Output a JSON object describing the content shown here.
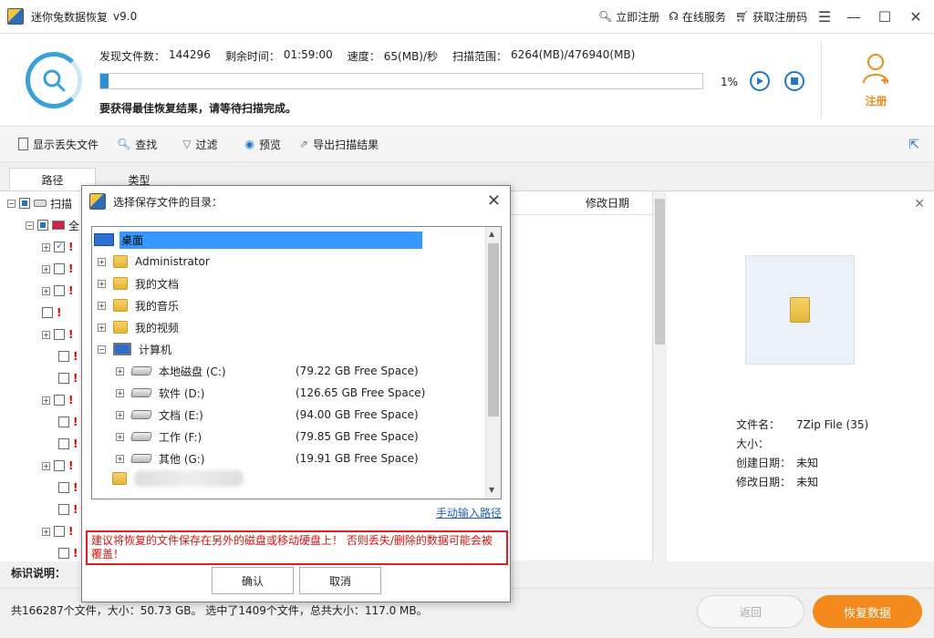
{
  "app": {
    "title": "迷你兔数据恢复",
    "version": "v9.0"
  },
  "titlebar": {
    "register": "立即注册",
    "service": "在线服务",
    "get_code": "获取注册码"
  },
  "scan": {
    "found_label": "发现文件数：",
    "found_value": "144296",
    "remain_label": "剩余时间：",
    "remain_value": "01:59:00",
    "speed_label": "速度：",
    "speed_value": "65(MB)/秒",
    "range_label": "扫描范围：",
    "range_value": "6264(MB)/476940(MB)",
    "progress_text": "1%",
    "progress_fraction": 0.013,
    "hint": "要获得最佳恢复结果，请等待扫描完成。",
    "register_label": "注册"
  },
  "toolbar": {
    "show_lost": "显示丢失文件",
    "find": "查找",
    "filter": "过滤",
    "preview": "预览",
    "export": "导出扫描结果"
  },
  "tabs": [
    "路径",
    "类型"
  ],
  "tree": {
    "root_label": "扫描",
    "child_label": "全"
  },
  "list": {
    "col_modified": "修改日期"
  },
  "preview": {
    "name_label": "文件名：",
    "name_value": "7Zip File (35)",
    "size_label": "大小：",
    "size_value": "",
    "created_label": "创建日期：",
    "created_value": "未知",
    "modified_label": "修改日期：",
    "modified_value": "未知"
  },
  "legend": "标识说明：",
  "status": {
    "text": "共166287个文件，大小：50.73 GB。 选中了1409个文件，总共大小：117.0 MB。"
  },
  "buttons": {
    "back": "返回",
    "recover": "恢复数据"
  },
  "dialog": {
    "title": "选择保存文件的目录：",
    "items": [
      {
        "label": "桌面"
      },
      {
        "label": "Administrator"
      },
      {
        "label": "我的文档"
      },
      {
        "label": "我的音乐"
      },
      {
        "label": "我的视频"
      },
      {
        "label": "计算机"
      },
      {
        "label": "本地磁盘 (C:)",
        "free": "(79.22 GB Free Space)"
      },
      {
        "label": "软件 (D:)",
        "free": "(126.65 GB Free Space)"
      },
      {
        "label": "文档 (E:)",
        "free": "(94.00 GB Free Space)"
      },
      {
        "label": "工作 (F:)",
        "free": "(79.85 GB Free Space)"
      },
      {
        "label": "其他 (G:)",
        "free": "(19.91 GB Free Space)"
      }
    ],
    "manual_path": "手动输入路径",
    "warning": "建议将恢复的文件保存在另外的磁盘或移动硬盘上！ 否则丢失/删除的数据可能会被覆盖！",
    "ok": "确认",
    "cancel": "取消"
  },
  "colors": {
    "accent": "#1f77c8",
    "orange": "#f38a1b",
    "warning": "#e01010"
  }
}
